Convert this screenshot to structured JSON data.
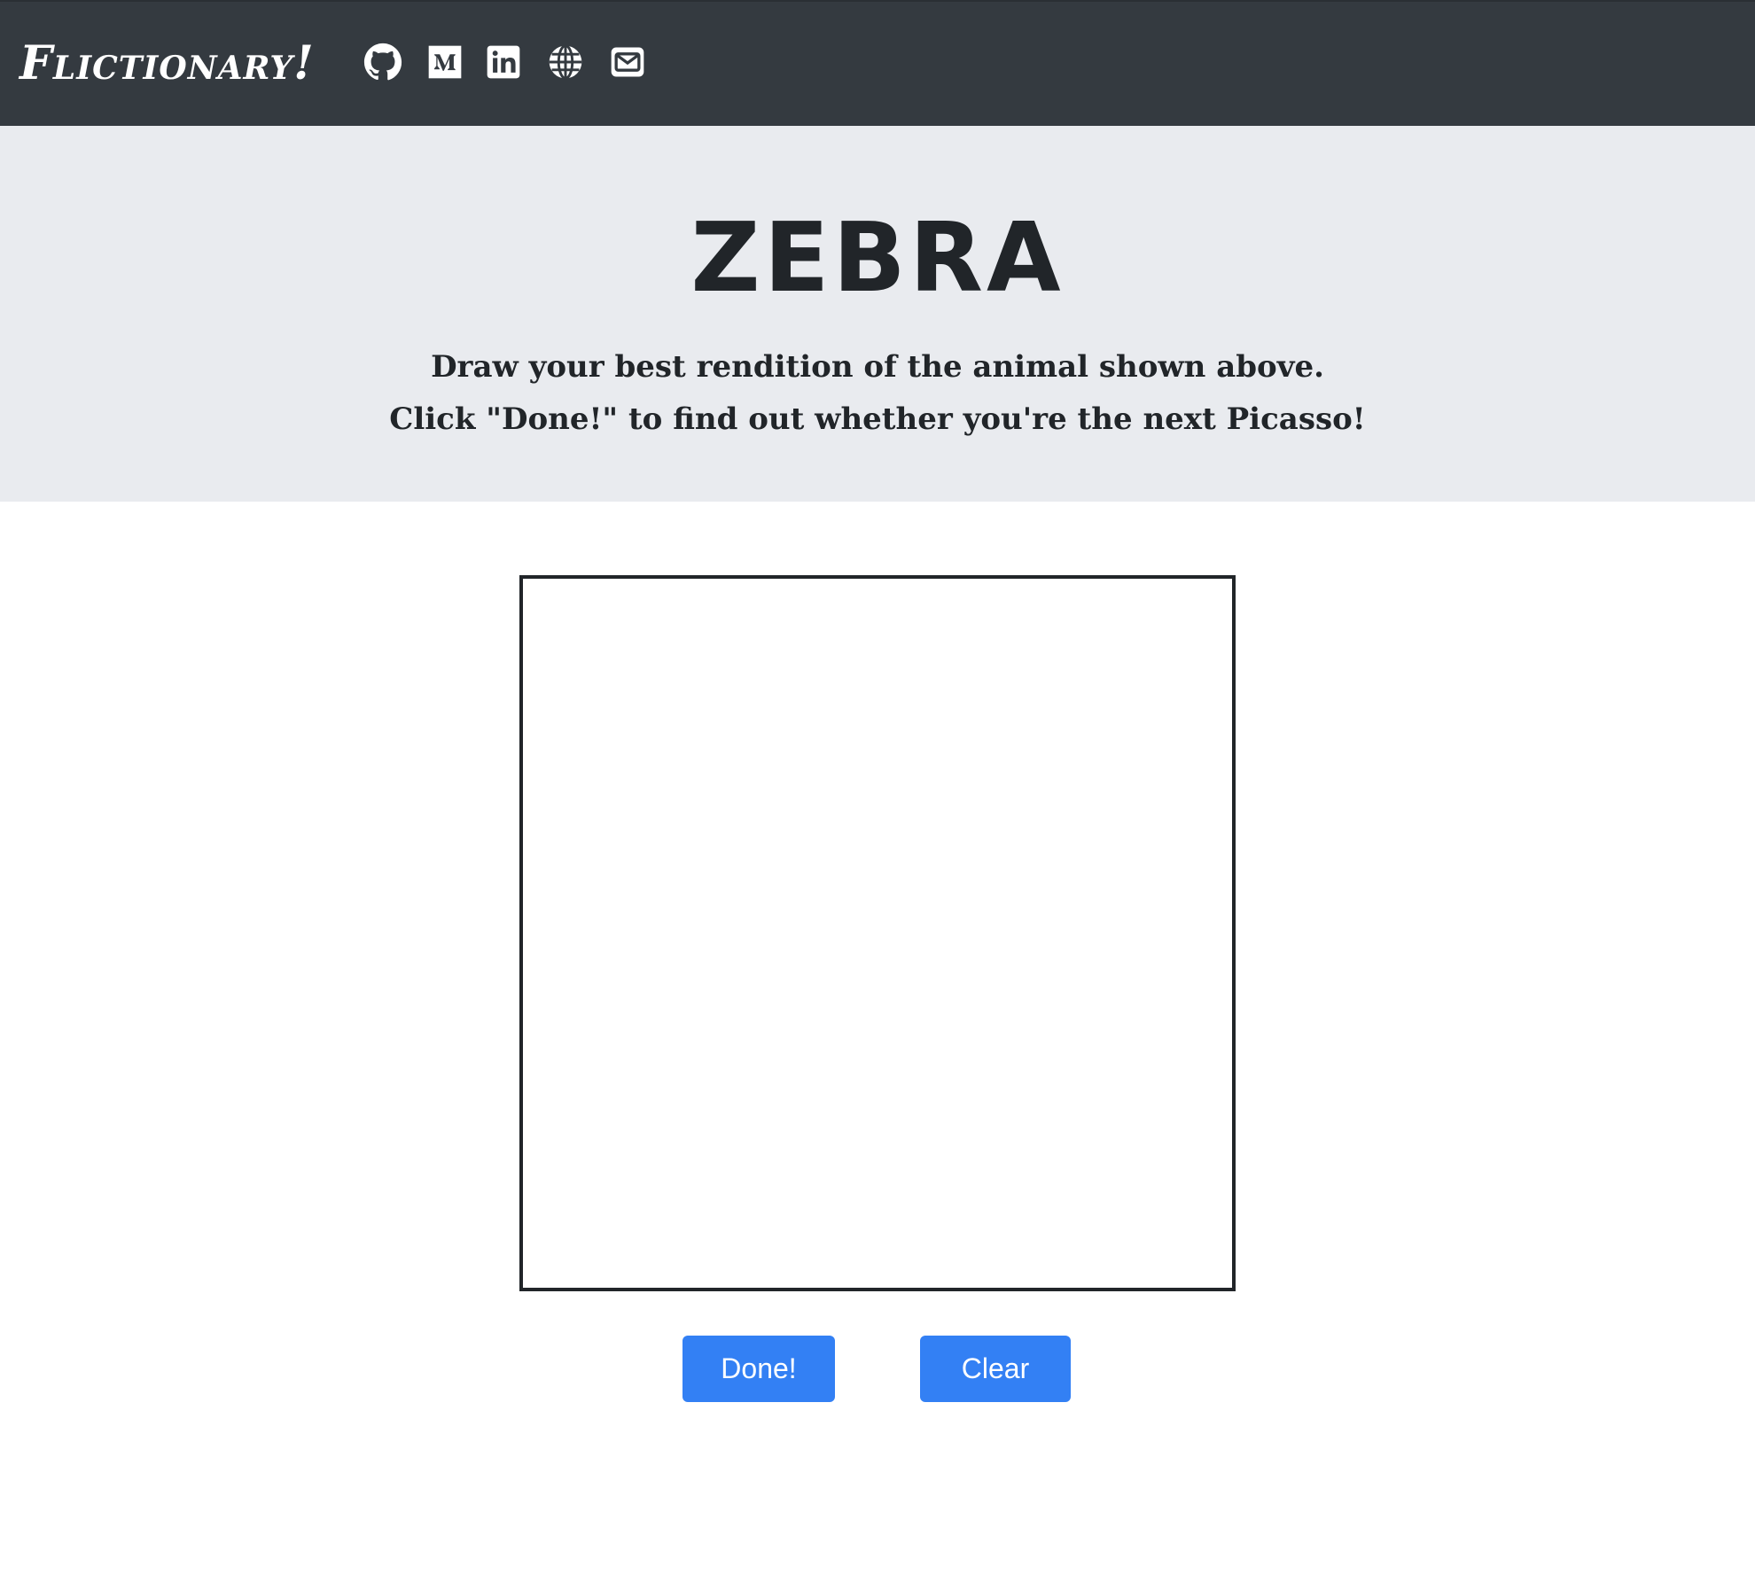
{
  "navbar": {
    "brand": "Flictionary!",
    "icons": [
      "github-icon",
      "medium-icon",
      "linkedin-icon",
      "globe-icon",
      "envelope-icon"
    ]
  },
  "hero": {
    "word": "ZEBRA",
    "instruction_line1": "Draw your best rendition of the animal shown above.",
    "instruction_line2": "Click \"Done!\" to find out whether you're the next Picasso!"
  },
  "buttons": {
    "done_label": "Done!",
    "clear_label": "Clear"
  },
  "colors": {
    "navbar_bg": "#343a40",
    "hero_bg": "#e9ebef",
    "button_bg": "#3380f4",
    "text_dark": "#212529"
  }
}
